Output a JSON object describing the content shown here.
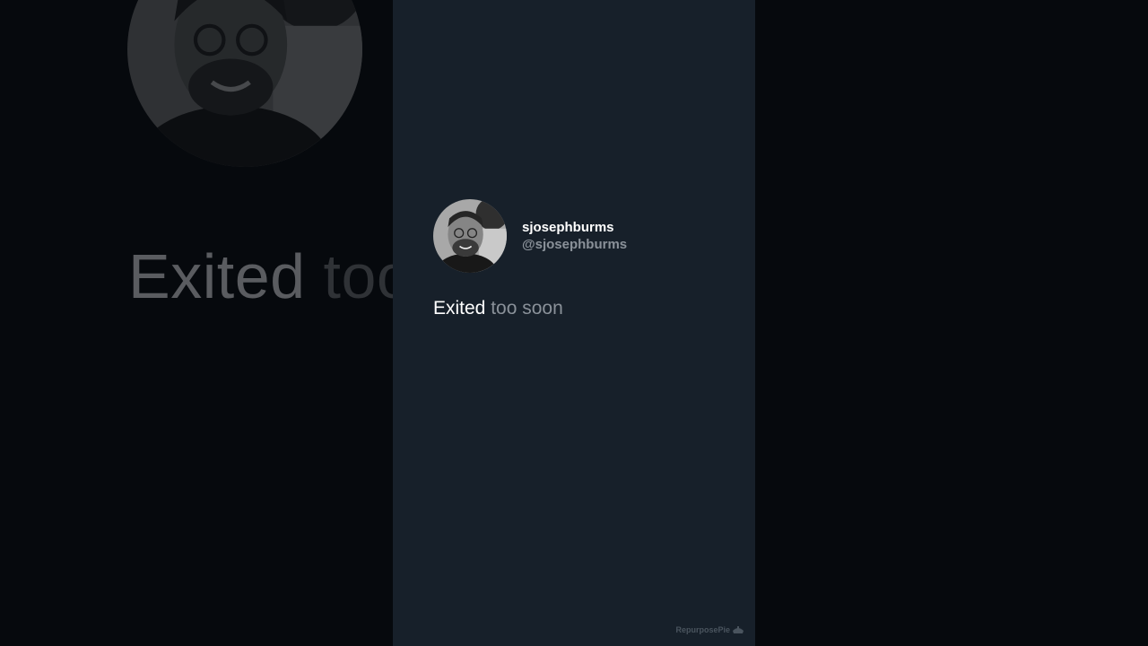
{
  "profile": {
    "display_name": "sjosephburms",
    "handle": "@sjosephburms",
    "avatar_icon": "person-photo-avatar"
  },
  "post": {
    "word_main": "Exited",
    "word_rest": "too soon"
  },
  "background_echo": {
    "word_main": "Exited",
    "word_rest": "too"
  },
  "watermark": {
    "label": "RepurposePie",
    "icon": "pie-icon"
  },
  "colors": {
    "page_background": "#06090d",
    "card_background": "#17202a",
    "text_primary": "#ffffff",
    "text_secondary": "#8a9199"
  }
}
